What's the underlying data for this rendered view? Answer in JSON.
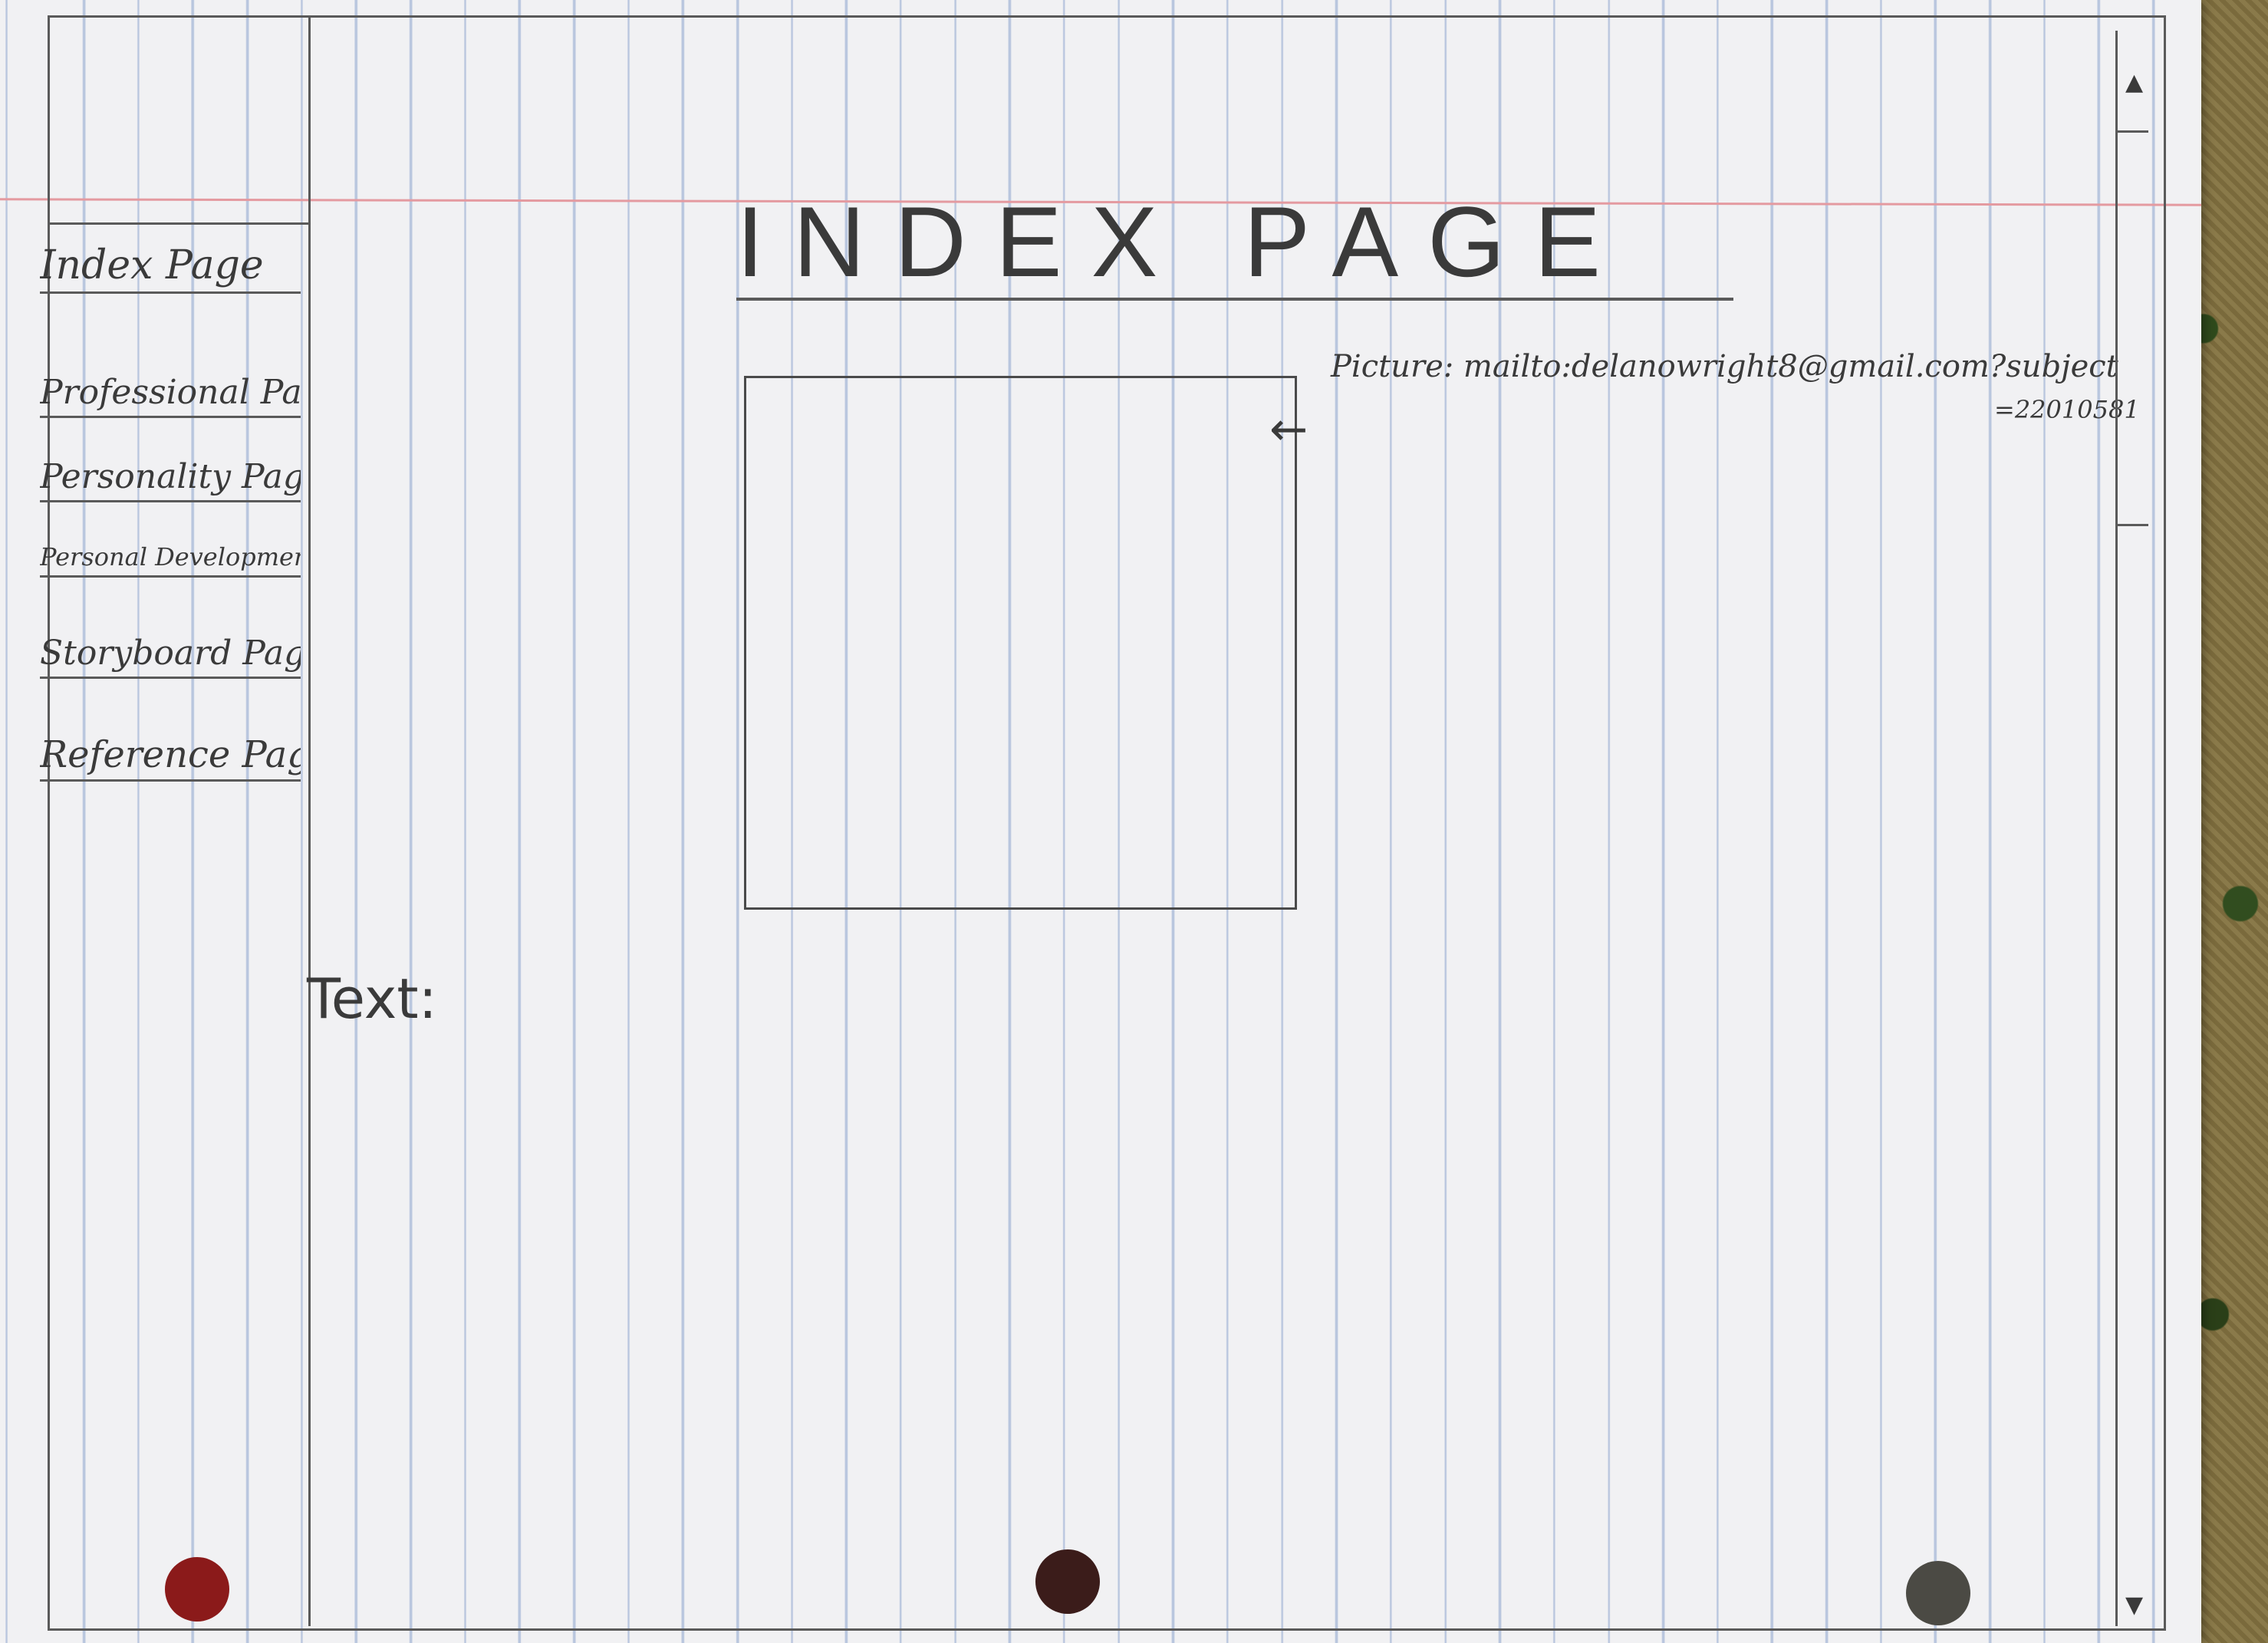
{
  "page": {
    "title": "INDEX PAGE"
  },
  "sidebar": {
    "items": [
      {
        "label": "Index Page"
      },
      {
        "label": "Professional Page"
      },
      {
        "label": "Personality Page"
      },
      {
        "label": "Personal Development Page"
      },
      {
        "label": "Storyboard Page"
      },
      {
        "label": "Reference Page"
      }
    ]
  },
  "main": {
    "picture_annotation": "Picture: mailto:delanowright8@gmail.com?subject",
    "picture_annotation_2": "=22010581",
    "text_label": "Text:"
  },
  "colors": {
    "paper": "#f1f1f3",
    "ink": "#3a3a3a",
    "rule": "#b9c6de",
    "margin": "#e49aa0"
  }
}
